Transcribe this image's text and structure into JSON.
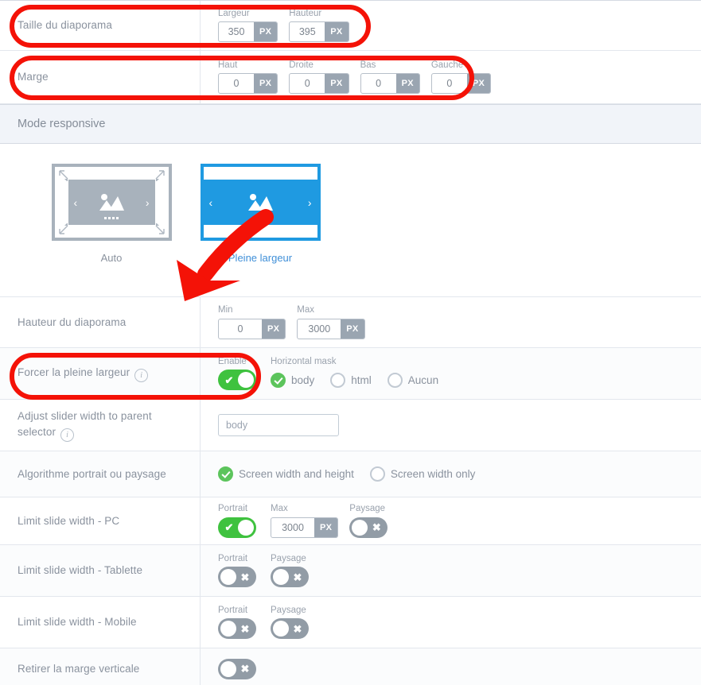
{
  "rows": {
    "slider_size": {
      "label": "Taille du diaporama",
      "fields": [
        {
          "label": "Largeur",
          "value": "350",
          "unit": "PX"
        },
        {
          "label": "Hauteur",
          "value": "395",
          "unit": "PX"
        }
      ]
    },
    "margin": {
      "label": "Marge",
      "fields": [
        {
          "label": "Haut",
          "value": "0",
          "unit": "PX"
        },
        {
          "label": "Droite",
          "value": "0",
          "unit": "PX"
        },
        {
          "label": "Bas",
          "value": "0",
          "unit": "PX"
        },
        {
          "label": "Gauche",
          "value": "0",
          "unit": "PX"
        }
      ]
    },
    "responsive_header": {
      "title": "Mode responsive"
    },
    "modes": {
      "auto": {
        "caption": "Auto",
        "selected": false
      },
      "full": {
        "caption": "Pleine largeur",
        "selected": true
      }
    },
    "slider_height": {
      "label": "Hauteur du diaporama",
      "fields": [
        {
          "label": "Min",
          "value": "0",
          "unit": "PX"
        },
        {
          "label": "Max",
          "value": "3000",
          "unit": "PX"
        }
      ]
    },
    "force_full_width": {
      "label": "Forcer la pleine largeur",
      "enable_label": "Enable",
      "enable_state": "on",
      "mask_label": "Horizontal mask",
      "mask_options": [
        {
          "label": "body",
          "checked": true
        },
        {
          "label": "html",
          "checked": false
        },
        {
          "label": "Aucun",
          "checked": false
        }
      ]
    },
    "adjust_parent": {
      "label": "Adjust slider width to parent selector",
      "value": "body",
      "placeholder": "body"
    },
    "algorithm": {
      "label": "Algorithme portrait ou paysage",
      "options": [
        {
          "label": "Screen width and height",
          "checked": true
        },
        {
          "label": "Screen width only",
          "checked": false
        }
      ]
    },
    "limit_pc": {
      "label": "Limit slide width - PC",
      "portrait_label": "Portrait",
      "portrait_state": "on",
      "max_label": "Max",
      "max_value": "3000",
      "max_unit": "PX",
      "paysage_label": "Paysage",
      "paysage_state": "off"
    },
    "limit_tablet": {
      "label": "Limit slide width - Tablette",
      "portrait_label": "Portrait",
      "portrait_state": "off",
      "paysage_label": "Paysage",
      "paysage_state": "off"
    },
    "limit_mobile": {
      "label": "Limit slide width - Mobile",
      "portrait_label": "Portrait",
      "portrait_state": "off",
      "paysage_label": "Paysage",
      "paysage_state": "off"
    },
    "remove_vertical_margin": {
      "label": "Retirer la marge verticale",
      "state": "off"
    }
  },
  "icons": {
    "info": "i",
    "check": "✔",
    "cross": "✖",
    "chevron_left": "‹",
    "chevron_right": "›"
  },
  "colors": {
    "accent_blue": "#1f9ae1",
    "toggle_on_green": "#3fc23f",
    "toggle_off_gray": "#929ca6",
    "annotation_red": "#f41207",
    "label_gray": "#8a929e",
    "header_bg": "#f1f4f9"
  }
}
